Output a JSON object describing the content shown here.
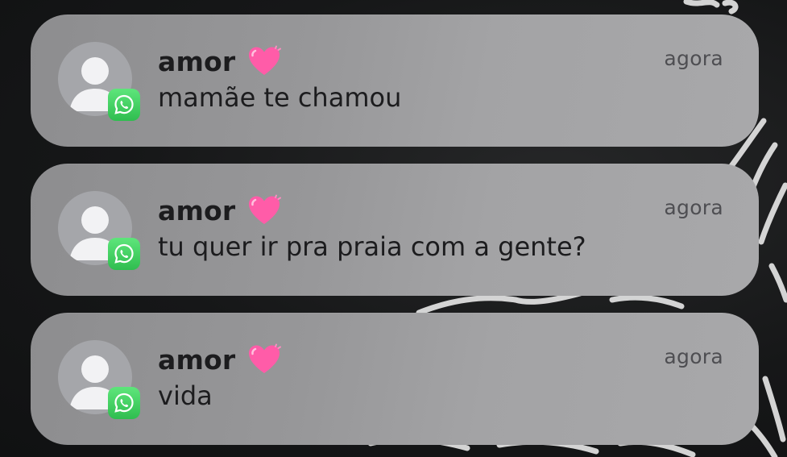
{
  "notifications": [
    {
      "sender": "amor",
      "time": "agora",
      "message": "mamãe te chamou",
      "app_icon": "whatsapp-icon",
      "emoji": "pink-heart-icon"
    },
    {
      "sender": "amor",
      "time": "agora",
      "message": "tu quer ir pra praia com a gente?",
      "app_icon": "whatsapp-icon",
      "emoji": "pink-heart-icon"
    },
    {
      "sender": "amor",
      "time": "agora",
      "message": "vida",
      "app_icon": "whatsapp-icon",
      "emoji": "pink-heart-icon"
    }
  ],
  "colors": {
    "badge_green": "#2fbd4f",
    "heart_pink": "#ff5ca8",
    "card_gray": "#9a9a9c"
  }
}
